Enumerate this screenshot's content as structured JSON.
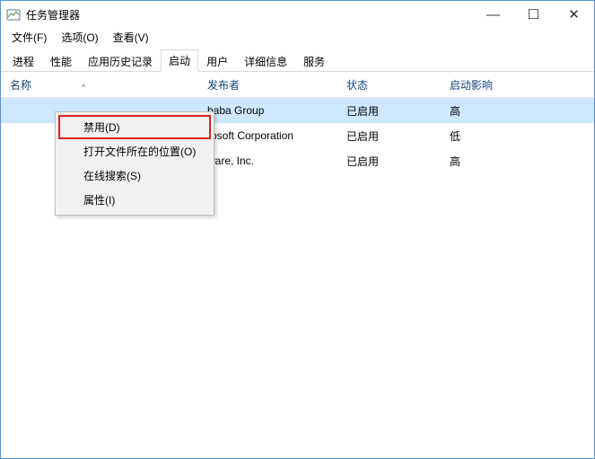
{
  "window": {
    "title": "任务管理器"
  },
  "win_controls": {
    "minimize": "—",
    "maximize": "☐",
    "close": "✕"
  },
  "menubar": {
    "file": "文件(F)",
    "options": "选项(O)",
    "view": "查看(V)"
  },
  "tabs": {
    "processes": "进程",
    "performance": "性能",
    "app_history": "应用历史记录",
    "startup": "启动",
    "users": "用户",
    "details": "详细信息",
    "services": "服务"
  },
  "columns": {
    "name": "名称",
    "publisher": "发布者",
    "status": "状态",
    "impact": "启动影响",
    "sort_glyph": "^"
  },
  "rows": [
    {
      "publisher": "baba Group",
      "status": "已启用",
      "impact": "高"
    },
    {
      "publisher": "rosoft Corporation",
      "status": "已启用",
      "impact": "低"
    },
    {
      "publisher": "ware, Inc.",
      "status": "已启用",
      "impact": "高"
    }
  ],
  "context_menu": {
    "disable": "禁用(D)",
    "open_file_location": "打开文件所在的位置(O)",
    "search_online": "在线搜索(S)",
    "properties": "属性(I)"
  }
}
